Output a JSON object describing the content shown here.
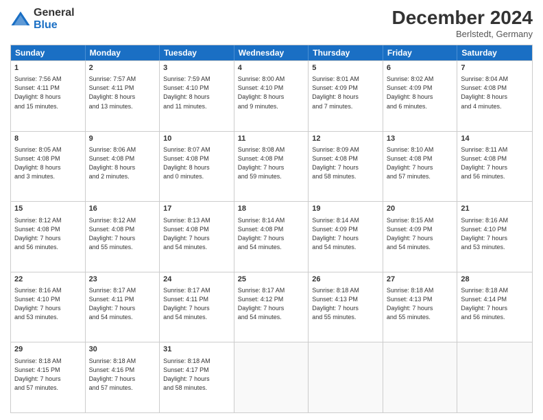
{
  "header": {
    "logo_general": "General",
    "logo_blue": "Blue",
    "month_title": "December 2024",
    "location": "Berlstedt, Germany"
  },
  "days_of_week": [
    "Sunday",
    "Monday",
    "Tuesday",
    "Wednesday",
    "Thursday",
    "Friday",
    "Saturday"
  ],
  "weeks": [
    [
      {
        "day": "1",
        "lines": [
          "Sunrise: 7:56 AM",
          "Sunset: 4:11 PM",
          "Daylight: 8 hours",
          "and 15 minutes."
        ]
      },
      {
        "day": "2",
        "lines": [
          "Sunrise: 7:57 AM",
          "Sunset: 4:11 PM",
          "Daylight: 8 hours",
          "and 13 minutes."
        ]
      },
      {
        "day": "3",
        "lines": [
          "Sunrise: 7:59 AM",
          "Sunset: 4:10 PM",
          "Daylight: 8 hours",
          "and 11 minutes."
        ]
      },
      {
        "day": "4",
        "lines": [
          "Sunrise: 8:00 AM",
          "Sunset: 4:10 PM",
          "Daylight: 8 hours",
          "and 9 minutes."
        ]
      },
      {
        "day": "5",
        "lines": [
          "Sunrise: 8:01 AM",
          "Sunset: 4:09 PM",
          "Daylight: 8 hours",
          "and 7 minutes."
        ]
      },
      {
        "day": "6",
        "lines": [
          "Sunrise: 8:02 AM",
          "Sunset: 4:09 PM",
          "Daylight: 8 hours",
          "and 6 minutes."
        ]
      },
      {
        "day": "7",
        "lines": [
          "Sunrise: 8:04 AM",
          "Sunset: 4:08 PM",
          "Daylight: 8 hours",
          "and 4 minutes."
        ]
      }
    ],
    [
      {
        "day": "8",
        "lines": [
          "Sunrise: 8:05 AM",
          "Sunset: 4:08 PM",
          "Daylight: 8 hours",
          "and 3 minutes."
        ]
      },
      {
        "day": "9",
        "lines": [
          "Sunrise: 8:06 AM",
          "Sunset: 4:08 PM",
          "Daylight: 8 hours",
          "and 2 minutes."
        ]
      },
      {
        "day": "10",
        "lines": [
          "Sunrise: 8:07 AM",
          "Sunset: 4:08 PM",
          "Daylight: 8 hours",
          "and 0 minutes."
        ]
      },
      {
        "day": "11",
        "lines": [
          "Sunrise: 8:08 AM",
          "Sunset: 4:08 PM",
          "Daylight: 7 hours",
          "and 59 minutes."
        ]
      },
      {
        "day": "12",
        "lines": [
          "Sunrise: 8:09 AM",
          "Sunset: 4:08 PM",
          "Daylight: 7 hours",
          "and 58 minutes."
        ]
      },
      {
        "day": "13",
        "lines": [
          "Sunrise: 8:10 AM",
          "Sunset: 4:08 PM",
          "Daylight: 7 hours",
          "and 57 minutes."
        ]
      },
      {
        "day": "14",
        "lines": [
          "Sunrise: 8:11 AM",
          "Sunset: 4:08 PM",
          "Daylight: 7 hours",
          "and 56 minutes."
        ]
      }
    ],
    [
      {
        "day": "15",
        "lines": [
          "Sunrise: 8:12 AM",
          "Sunset: 4:08 PM",
          "Daylight: 7 hours",
          "and 56 minutes."
        ]
      },
      {
        "day": "16",
        "lines": [
          "Sunrise: 8:12 AM",
          "Sunset: 4:08 PM",
          "Daylight: 7 hours",
          "and 55 minutes."
        ]
      },
      {
        "day": "17",
        "lines": [
          "Sunrise: 8:13 AM",
          "Sunset: 4:08 PM",
          "Daylight: 7 hours",
          "and 54 minutes."
        ]
      },
      {
        "day": "18",
        "lines": [
          "Sunrise: 8:14 AM",
          "Sunset: 4:08 PM",
          "Daylight: 7 hours",
          "and 54 minutes."
        ]
      },
      {
        "day": "19",
        "lines": [
          "Sunrise: 8:14 AM",
          "Sunset: 4:09 PM",
          "Daylight: 7 hours",
          "and 54 minutes."
        ]
      },
      {
        "day": "20",
        "lines": [
          "Sunrise: 8:15 AM",
          "Sunset: 4:09 PM",
          "Daylight: 7 hours",
          "and 54 minutes."
        ]
      },
      {
        "day": "21",
        "lines": [
          "Sunrise: 8:16 AM",
          "Sunset: 4:10 PM",
          "Daylight: 7 hours",
          "and 53 minutes."
        ]
      }
    ],
    [
      {
        "day": "22",
        "lines": [
          "Sunrise: 8:16 AM",
          "Sunset: 4:10 PM",
          "Daylight: 7 hours",
          "and 53 minutes."
        ]
      },
      {
        "day": "23",
        "lines": [
          "Sunrise: 8:17 AM",
          "Sunset: 4:11 PM",
          "Daylight: 7 hours",
          "and 54 minutes."
        ]
      },
      {
        "day": "24",
        "lines": [
          "Sunrise: 8:17 AM",
          "Sunset: 4:11 PM",
          "Daylight: 7 hours",
          "and 54 minutes."
        ]
      },
      {
        "day": "25",
        "lines": [
          "Sunrise: 8:17 AM",
          "Sunset: 4:12 PM",
          "Daylight: 7 hours",
          "and 54 minutes."
        ]
      },
      {
        "day": "26",
        "lines": [
          "Sunrise: 8:18 AM",
          "Sunset: 4:13 PM",
          "Daylight: 7 hours",
          "and 55 minutes."
        ]
      },
      {
        "day": "27",
        "lines": [
          "Sunrise: 8:18 AM",
          "Sunset: 4:13 PM",
          "Daylight: 7 hours",
          "and 55 minutes."
        ]
      },
      {
        "day": "28",
        "lines": [
          "Sunrise: 8:18 AM",
          "Sunset: 4:14 PM",
          "Daylight: 7 hours",
          "and 56 minutes."
        ]
      }
    ],
    [
      {
        "day": "29",
        "lines": [
          "Sunrise: 8:18 AM",
          "Sunset: 4:15 PM",
          "Daylight: 7 hours",
          "and 57 minutes."
        ]
      },
      {
        "day": "30",
        "lines": [
          "Sunrise: 8:18 AM",
          "Sunset: 4:16 PM",
          "Daylight: 7 hours",
          "and 57 minutes."
        ]
      },
      {
        "day": "31",
        "lines": [
          "Sunrise: 8:18 AM",
          "Sunset: 4:17 PM",
          "Daylight: 7 hours",
          "and 58 minutes."
        ]
      },
      {
        "day": "",
        "lines": []
      },
      {
        "day": "",
        "lines": []
      },
      {
        "day": "",
        "lines": []
      },
      {
        "day": "",
        "lines": []
      }
    ]
  ]
}
